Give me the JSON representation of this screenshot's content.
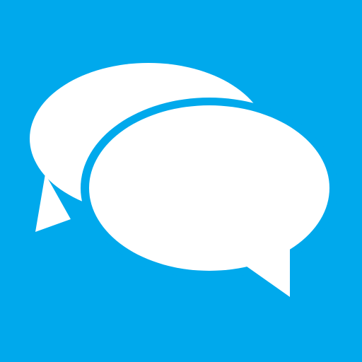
{
  "icon": {
    "name": "chat-bubbles-icon",
    "background_color": "#00a9ec",
    "foreground_color": "#ffffff"
  }
}
